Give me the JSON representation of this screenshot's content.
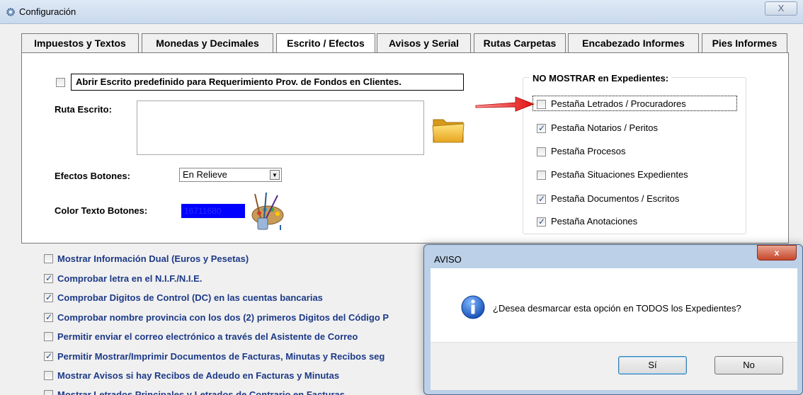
{
  "window": {
    "title": "Configuración",
    "close_label": "X"
  },
  "tabs": [
    {
      "label": "Impuestos y Textos",
      "active": false
    },
    {
      "label": "Monedas y Decimales",
      "active": false
    },
    {
      "label": "Escrito / Efectos",
      "active": true
    },
    {
      "label": "Avisos y Serial",
      "active": false
    },
    {
      "label": "Rutas Carpetas",
      "active": false
    },
    {
      "label": "Encabezado Informes",
      "active": false
    },
    {
      "label": "Pies Informes",
      "active": false
    }
  ],
  "escrito": {
    "abrir_label": "Abrir Escrito predefinido para Requerimiento Prov. de Fondos en Clientes.",
    "abrir_checked": false,
    "ruta_label": "Ruta Escrito:",
    "ruta_value": ""
  },
  "efectos": {
    "label": "Efectos Botones:",
    "selected": "En Relieve",
    "color_label": "Color Texto Botones:",
    "color_value": "16711680",
    "color_hex": "#0000ff"
  },
  "no_mostrar": {
    "title": "NO MOSTRAR en Expedientes:",
    "items": [
      {
        "label": "Pestaña Letrados / Procuradores",
        "checked": false
      },
      {
        "label": "Pestaña Notarios / Peritos",
        "checked": true
      },
      {
        "label": "Pestaña Procesos",
        "checked": false
      },
      {
        "label": "Pestaña Situaciones Expedientes",
        "checked": false
      },
      {
        "label": "Pestaña Documentos / Escritos",
        "checked": true
      },
      {
        "label": "Pestaña Anotaciones",
        "checked": true
      }
    ]
  },
  "options": [
    {
      "label": "Mostrar Información Dual (Euros y Pesetas)",
      "checked": false
    },
    {
      "label": "Comprobar letra en el N.I.F./N.I.E.",
      "checked": true
    },
    {
      "label": "Comprobar Digitos de Control (DC) en las cuentas bancarias",
      "checked": true
    },
    {
      "label": "Comprobar nombre provincia con los dos (2) primeros Digitos del Código P",
      "checked": true
    },
    {
      "label": "Permitir enviar el correo electrónico a través del Asistente de Correo",
      "checked": false
    },
    {
      "label": "Permitir Mostrar/Imprimir Documentos de Facturas, Minutas y Recibos seg",
      "checked": true
    },
    {
      "label": "Mostrar Avisos si hay Recibos de Adeudo en Facturas y Minutas",
      "checked": false
    },
    {
      "label": "Mostrar Letrados Principales y Letrados de Contrario en Facturas",
      "checked": false
    }
  ],
  "dialog": {
    "title": "AVISO",
    "message": "¿Desea desmarcar esta opción en TODOS los Expedientes?",
    "yes_label": "Sí",
    "no_label": "No",
    "close_label": "x"
  },
  "colors": {
    "option_text": "#1d3a87",
    "arrow": "#e02020"
  }
}
